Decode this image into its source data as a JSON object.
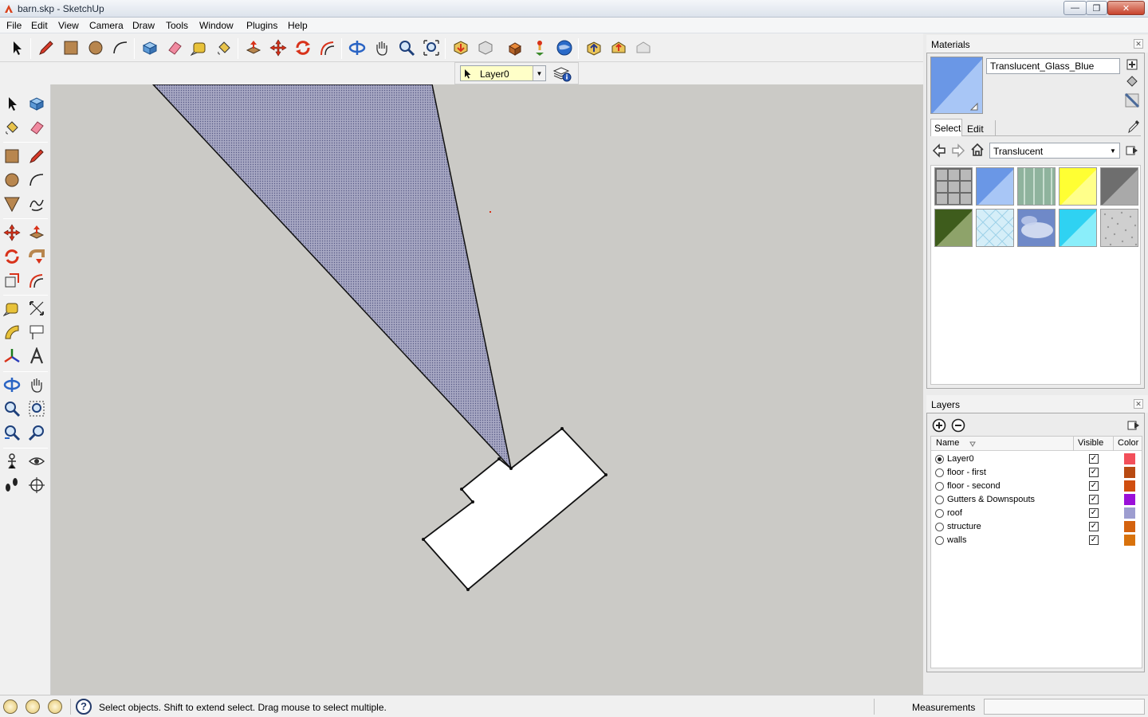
{
  "window": {
    "title": "barn.skp - SketchUp",
    "minimize": "—",
    "maximize": "❐",
    "close": "✕"
  },
  "menu": [
    "File",
    "Edit",
    "View",
    "Camera",
    "Draw",
    "Tools",
    "Window",
    "Plugins",
    "Help"
  ],
  "layer_toolbar": {
    "current_layer": "Layer0"
  },
  "materials": {
    "title": "Materials",
    "current_name": "Translucent_Glass_Blue",
    "tabs": {
      "select": "Select",
      "edit": "Edit"
    },
    "collection": "Translucent",
    "swatch_colors": [
      "#6a6a6a",
      "#6a97e6",
      "#8fb39d",
      "#ffff33",
      "#8a8a8a",
      "#3e5c1c",
      "#d5eef8",
      "#6f89c8",
      "#2fd2f2",
      "#cfcfcf"
    ]
  },
  "layers": {
    "title": "Layers",
    "columns": {
      "name": "Name",
      "visible": "Visible",
      "color": "Color"
    },
    "rows": [
      {
        "name": "Layer0",
        "active": true,
        "visible": true,
        "color": "#f24f5a"
      },
      {
        "name": "floor - first",
        "active": false,
        "visible": true,
        "color": "#b84a12"
      },
      {
        "name": "floor - second",
        "active": false,
        "visible": true,
        "color": "#d04e0f"
      },
      {
        "name": "Gutters & Downspouts",
        "active": false,
        "visible": true,
        "color": "#9a10d8"
      },
      {
        "name": "roof",
        "active": false,
        "visible": true,
        "color": "#9d9dd0"
      },
      {
        "name": "structure",
        "active": false,
        "visible": true,
        "color": "#d4620e"
      },
      {
        "name": "walls",
        "active": false,
        "visible": true,
        "color": "#d8720c"
      }
    ]
  },
  "status": {
    "message": "Select objects. Shift to extend select. Drag mouse to select multiple.",
    "measurements_label": "Measurements",
    "help": "?"
  },
  "viewport": {
    "background": "#cbcac6",
    "plane_fill": "#9798b4",
    "building_fill": "#ffffff"
  }
}
